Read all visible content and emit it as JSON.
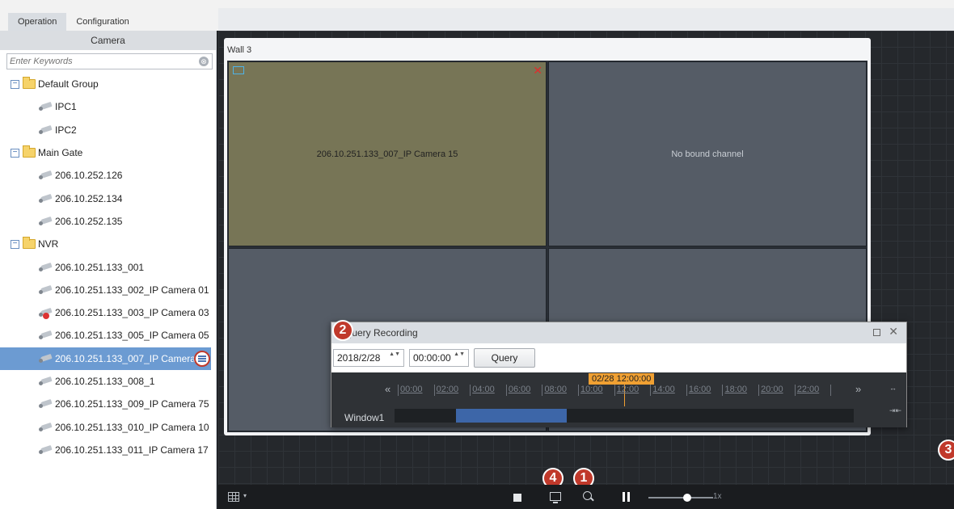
{
  "tabs": [
    "Operation",
    "Configuration"
  ],
  "left_panel": {
    "title": "Camera",
    "search_placeholder": "Enter Keywords",
    "tree": [
      {
        "type": "group",
        "label": "Default Group"
      },
      {
        "type": "camera",
        "label": "IPC1"
      },
      {
        "type": "camera",
        "label": "IPC2"
      },
      {
        "type": "group",
        "label": "Main Gate"
      },
      {
        "type": "camera",
        "label": "206.10.252.126"
      },
      {
        "type": "camera",
        "label": "206.10.252.134"
      },
      {
        "type": "camera",
        "label": "206.10.252.135"
      },
      {
        "type": "group",
        "label": "NVR"
      },
      {
        "type": "camera",
        "label": "206.10.251.133_001"
      },
      {
        "type": "camera",
        "label": "206.10.251.133_002_IP Camera 01"
      },
      {
        "type": "camera",
        "label": "206.10.251.133_003_IP Camera 03",
        "status": "error"
      },
      {
        "type": "camera",
        "label": "206.10.251.133_005_IP Camera 05"
      },
      {
        "type": "camera",
        "label": "206.10.251.133_007_IP Camera",
        "selected": true
      },
      {
        "type": "camera",
        "label": "206.10.251.133_008_1"
      },
      {
        "type": "camera",
        "label": "206.10.251.133_009_IP Camera 75"
      },
      {
        "type": "camera",
        "label": "206.10.251.133_010_IP Camera 10"
      },
      {
        "type": "camera",
        "label": "206.10.251.133_011_IP Camera 17"
      }
    ]
  },
  "wall": {
    "title": "Wall 3",
    "windows": [
      {
        "label": "206.10.251.133_007_IP Camera 15"
      },
      {
        "label": "No bound channel"
      },
      {
        "label": ""
      },
      {
        "label": ""
      }
    ]
  },
  "query_dialog": {
    "title": "Query Recording",
    "date": "2018/2/28",
    "time": "00:00:00",
    "query_label": "Query",
    "marker": "02/28  12:00:00",
    "marker_hour": 12,
    "ticks": [
      "00:00",
      "02:00",
      "04:00",
      "06:00",
      "08:00",
      "10:00",
      "12:00",
      "14:00",
      "16:00",
      "18:00",
      "20:00",
      "22:00",
      ""
    ],
    "prev_label": "«",
    "next_label": "»",
    "expand_label": "↔",
    "collapse_label": "⇥⇤",
    "row_label": "Window1",
    "recording_hours": [
      3.2,
      9.0
    ]
  },
  "badges": [
    "1",
    "2",
    "3",
    "4"
  ],
  "bottombar": {
    "speed": "1x",
    "speed_level": 0.6
  },
  "icons": {
    "clear": "⊗",
    "close": "✕",
    "folder_toggle": "−",
    "dropdown": "▾",
    "spin": "▲▼"
  },
  "colors": {
    "selected_row": "#6c9bd2",
    "active_window": "#777556",
    "marker": "#f0a032",
    "recording": "#3d66a8",
    "badge": "#c0392b"
  }
}
